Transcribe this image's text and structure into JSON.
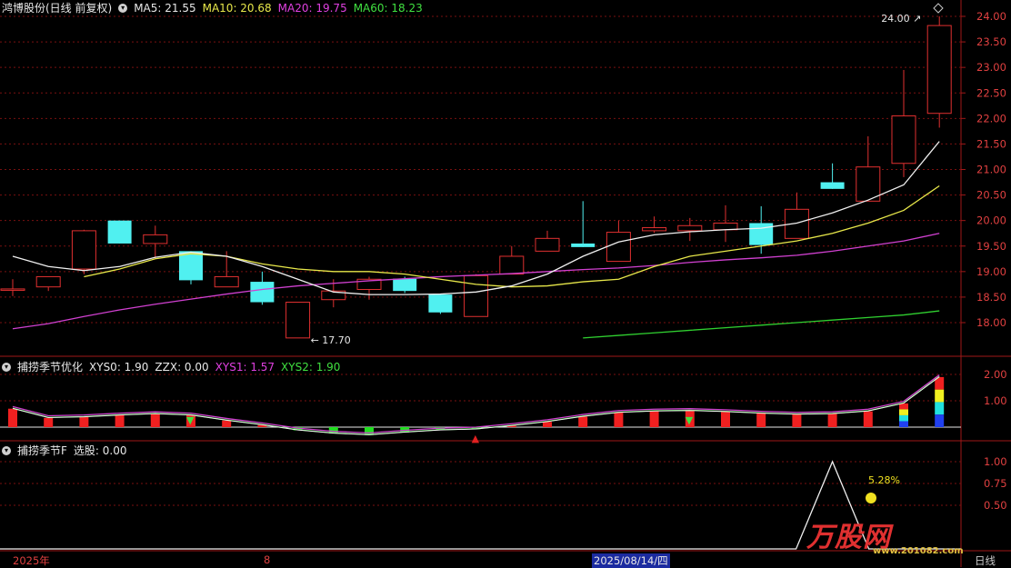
{
  "header": {
    "stock": "鸿博股份(日线 前复权)",
    "ma": [
      {
        "label": "MA5: 21.55",
        "color": "#e8e8e8"
      },
      {
        "label": "MA10: 20.68",
        "color": "#e8e84a"
      },
      {
        "label": "MA20: 19.75",
        "color": "#e040e0"
      },
      {
        "label": "MA60: 18.23",
        "color": "#40e040"
      }
    ]
  },
  "indicator1": {
    "name": "捕捞季节优化",
    "values": [
      {
        "label": "XYS0: 1.90",
        "color": "#e8e8e8"
      },
      {
        "label": "ZZX: 0.00",
        "color": "#e8e8e8"
      },
      {
        "label": "XYS1: 1.57",
        "color": "#e040e0"
      },
      {
        "label": "XYS2: 1.90",
        "color": "#40e040"
      }
    ],
    "yticks": [
      "2.00",
      "1.00"
    ]
  },
  "indicator2": {
    "name": "捕捞季节F",
    "values": [
      {
        "label": "选股: 0.00",
        "color": "#e8e8e8"
      }
    ],
    "yticks": [
      "1.00",
      "0.75",
      "0.50"
    ],
    "pct_label": "5.28%"
  },
  "price_axis": [
    "24.00",
    "23.50",
    "23.00",
    "22.50",
    "22.00",
    "21.50",
    "21.00",
    "20.50",
    "20.00",
    "19.50",
    "19.00",
    "18.50",
    "18.00"
  ],
  "annotations": {
    "high": "24.00",
    "low": "17.70"
  },
  "x_axis": {
    "labels": [
      "2025年",
      "8",
      "2025/08/14/四"
    ],
    "period": "日线"
  },
  "watermark": {
    "brand": "万股网",
    "url": "www.201082.com"
  },
  "colors": {
    "up": "#e03030",
    "down": "#50f0f0",
    "grid": "#7a1010"
  },
  "chart_data": {
    "type": "candlestick",
    "candles": [
      {
        "o": 18.66,
        "h": 18.85,
        "l": 18.52,
        "c": 18.66
      },
      {
        "o": 18.7,
        "h": 18.9,
        "l": 18.62,
        "c": 18.9
      },
      {
        "o": 19.05,
        "h": 19.82,
        "l": 18.95,
        "c": 19.8
      },
      {
        "o": 20.0,
        "h": 20.0,
        "l": 19.55,
        "c": 19.55
      },
      {
        "o": 19.55,
        "h": 19.9,
        "l": 19.25,
        "c": 19.72
      },
      {
        "o": 19.4,
        "h": 19.4,
        "l": 18.75,
        "c": 18.83
      },
      {
        "o": 18.7,
        "h": 19.4,
        "l": 18.7,
        "c": 18.9
      },
      {
        "o": 18.8,
        "h": 19.0,
        "l": 18.35,
        "c": 18.4
      },
      {
        "o": 17.7,
        "h": 18.4,
        "l": 17.7,
        "c": 18.4
      },
      {
        "o": 18.45,
        "h": 18.85,
        "l": 18.3,
        "c": 18.62
      },
      {
        "o": 18.65,
        "h": 18.9,
        "l": 18.45,
        "c": 18.85
      },
      {
        "o": 18.86,
        "h": 18.9,
        "l": 18.58,
        "c": 18.62
      },
      {
        "o": 18.55,
        "h": 18.55,
        "l": 18.17,
        "c": 18.2
      },
      {
        "o": 18.12,
        "h": 18.95,
        "l": 18.12,
        "c": 18.92
      },
      {
        "o": 18.95,
        "h": 19.5,
        "l": 18.95,
        "c": 19.3
      },
      {
        "o": 19.4,
        "h": 19.8,
        "l": 19.4,
        "c": 19.65
      },
      {
        "o": 19.55,
        "h": 20.38,
        "l": 19.48,
        "c": 19.48
      },
      {
        "o": 19.2,
        "h": 20.0,
        "l": 19.2,
        "c": 19.77
      },
      {
        "o": 19.8,
        "h": 20.08,
        "l": 19.76,
        "c": 19.86
      },
      {
        "o": 19.8,
        "h": 20.05,
        "l": 19.6,
        "c": 19.9
      },
      {
        "o": 19.82,
        "h": 20.3,
        "l": 19.58,
        "c": 19.95
      },
      {
        "o": 19.95,
        "h": 20.28,
        "l": 19.35,
        "c": 19.52
      },
      {
        "o": 19.65,
        "h": 20.55,
        "l": 19.65,
        "c": 20.22
      },
      {
        "o": 20.75,
        "h": 21.12,
        "l": 20.62,
        "c": 20.62
      },
      {
        "o": 20.38,
        "h": 21.65,
        "l": 20.38,
        "c": 21.05
      },
      {
        "o": 21.12,
        "h": 22.95,
        "l": 20.85,
        "c": 22.05
      },
      {
        "o": 22.1,
        "h": 24.0,
        "l": 21.82,
        "c": 23.82
      }
    ],
    "ma5": [
      19.3,
      19.1,
      19.02,
      19.1,
      19.28,
      19.38,
      19.3,
      19.1,
      18.85,
      18.6,
      18.55,
      18.55,
      18.56,
      18.6,
      18.72,
      18.95,
      19.3,
      19.58,
      19.72,
      19.78,
      19.82,
      19.85,
      19.95,
      20.15,
      20.4,
      20.7,
      21.55
    ],
    "ma10": [
      null,
      null,
      18.9,
      19.05,
      19.25,
      19.35,
      19.3,
      19.15,
      19.05,
      19.0,
      19.0,
      18.95,
      18.85,
      18.75,
      18.7,
      18.72,
      18.8,
      18.85,
      19.1,
      19.3,
      19.4,
      19.5,
      19.6,
      19.75,
      19.95,
      20.2,
      20.68
    ],
    "ma20": [
      17.88,
      17.98,
      18.12,
      18.25,
      18.36,
      18.46,
      18.56,
      18.65,
      18.72,
      18.77,
      18.82,
      18.86,
      18.9,
      18.93,
      18.96,
      19.0,
      19.04,
      19.07,
      19.12,
      19.18,
      19.23,
      19.27,
      19.32,
      19.4,
      19.5,
      19.6,
      19.75
    ],
    "ma60": [
      null,
      null,
      null,
      null,
      null,
      null,
      null,
      null,
      null,
      null,
      null,
      null,
      null,
      null,
      null,
      null,
      17.7,
      17.75,
      17.8,
      17.85,
      17.9,
      17.95,
      18.0,
      18.05,
      18.1,
      18.15,
      18.23
    ],
    "ind1_bars": [
      0.7,
      0.35,
      0.38,
      0.45,
      0.5,
      0.45,
      0.25,
      0.08,
      -0.12,
      -0.24,
      -0.3,
      -0.2,
      -0.12,
      -0.08,
      0.05,
      0.2,
      0.4,
      0.55,
      0.6,
      0.62,
      0.58,
      0.52,
      0.48,
      0.5,
      0.6,
      0.9,
      1.9
    ],
    "ind2_peak": 1.0
  }
}
